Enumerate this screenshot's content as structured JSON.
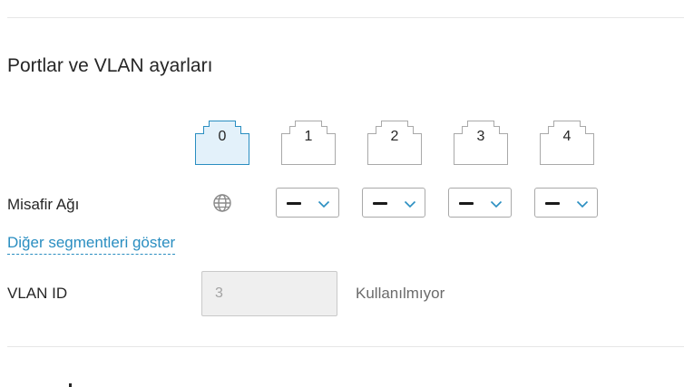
{
  "section": {
    "title": "Portlar ve VLAN ayarları"
  },
  "ports": [
    {
      "label": "0",
      "active": true
    },
    {
      "label": "1",
      "active": false
    },
    {
      "label": "2",
      "active": false
    },
    {
      "label": "3",
      "active": false
    },
    {
      "label": "4",
      "active": false
    }
  ],
  "guest_network": {
    "label": "Misafir Ağı",
    "icon": "globe-icon",
    "selects": [
      {
        "port": "1",
        "value": "—"
      },
      {
        "port": "2",
        "value": "—"
      },
      {
        "port": "3",
        "value": "—"
      },
      {
        "port": "4",
        "value": "—"
      }
    ]
  },
  "show_segments_link": "Diğer segmentleri göster",
  "vlan": {
    "label": "VLAN ID",
    "value": "3",
    "status": "Kullanılmıyor"
  },
  "colors": {
    "active_port_fill": "#e3f1fa",
    "active_port_border": "#2a8ec1",
    "link": "#2a8ec1",
    "chevron": "#2a8ec1"
  }
}
